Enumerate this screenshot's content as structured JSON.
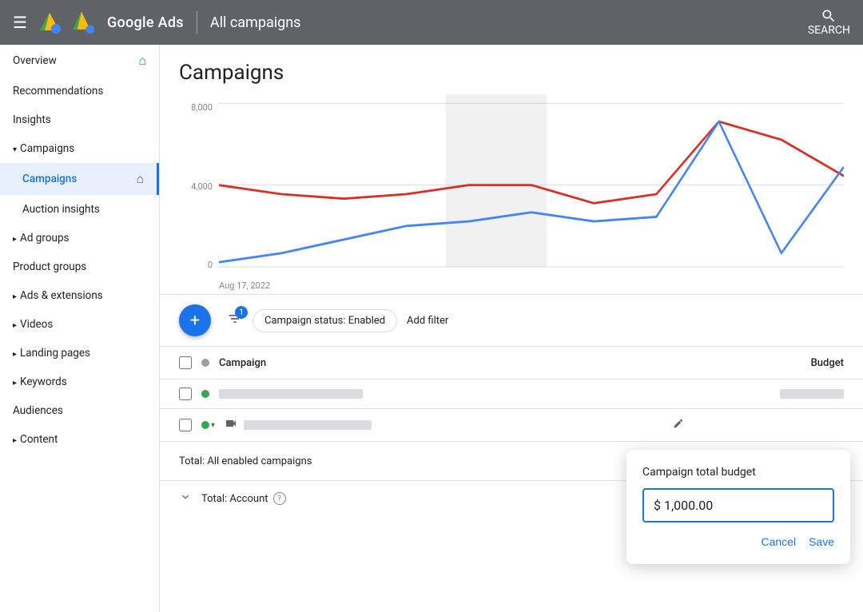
{
  "topbar": {
    "menu_label": "☰",
    "brand": "Google Ads",
    "divider": "|",
    "title": "All campaigns",
    "search_label": "SEARCH"
  },
  "sidebar": {
    "items": [
      {
        "id": "overview",
        "label": "Overview",
        "indent": false,
        "active": false,
        "has_icon": true,
        "expandable": false
      },
      {
        "id": "recommendations",
        "label": "Recommendations",
        "indent": false,
        "active": false,
        "has_icon": false,
        "expandable": false
      },
      {
        "id": "insights",
        "label": "Insights",
        "indent": false,
        "active": false,
        "has_icon": false,
        "expandable": false
      },
      {
        "id": "campaigns-header",
        "label": "Campaigns",
        "indent": false,
        "active": false,
        "has_icon": false,
        "expandable": true,
        "expanded": true
      },
      {
        "id": "campaigns",
        "label": "Campaigns",
        "indent": true,
        "active": true,
        "has_icon": true,
        "expandable": false
      },
      {
        "id": "auction-insights",
        "label": "Auction insights",
        "indent": true,
        "active": false,
        "has_icon": false,
        "expandable": false
      },
      {
        "id": "ad-groups",
        "label": "Ad groups",
        "indent": false,
        "active": false,
        "has_icon": false,
        "expandable": true,
        "expanded": false
      },
      {
        "id": "product-groups",
        "label": "Product groups",
        "indent": false,
        "active": false,
        "has_icon": false,
        "expandable": false
      },
      {
        "id": "ads-extensions",
        "label": "Ads & extensions",
        "indent": false,
        "active": false,
        "has_icon": false,
        "expandable": true,
        "expanded": false
      },
      {
        "id": "videos",
        "label": "Videos",
        "indent": false,
        "active": false,
        "has_icon": false,
        "expandable": true,
        "expanded": false
      },
      {
        "id": "landing-pages",
        "label": "Landing pages",
        "indent": false,
        "active": false,
        "has_icon": false,
        "expandable": true,
        "expanded": false
      },
      {
        "id": "keywords",
        "label": "Keywords",
        "indent": false,
        "active": false,
        "has_icon": false,
        "expandable": true,
        "expanded": false
      },
      {
        "id": "audiences",
        "label": "Audiences",
        "indent": false,
        "active": false,
        "has_icon": false,
        "expandable": false
      },
      {
        "id": "content",
        "label": "Content",
        "indent": false,
        "active": false,
        "has_icon": false,
        "expandable": true,
        "expanded": false
      }
    ]
  },
  "page": {
    "title": "Campaigns"
  },
  "chart": {
    "y_labels": [
      "8,000",
      "4,000",
      "0"
    ],
    "x_label": "Aug 17, 2022"
  },
  "filter_bar": {
    "fab_label": "+",
    "filter_badge": "1",
    "campaign_status_chip": "Campaign status: Enabled",
    "add_filter_label": "Add filter"
  },
  "table": {
    "columns": [
      "Campaign",
      "Budget"
    ],
    "rows": [
      {
        "status": "green",
        "has_video": false,
        "redacted_width": 180,
        "budget_width": 80
      },
      {
        "status": "green",
        "has_video": true,
        "redacted_width": 160,
        "budget_width": 0
      }
    ],
    "total_label": "Total: All enabled campaigns",
    "total_account_label": "Total: Account"
  },
  "budget_popup": {
    "title": "Campaign total budget",
    "value": "$ 1,000.00",
    "cancel_label": "Cancel",
    "save_label": "Save"
  },
  "arrow": {
    "color": "#22c55e"
  }
}
